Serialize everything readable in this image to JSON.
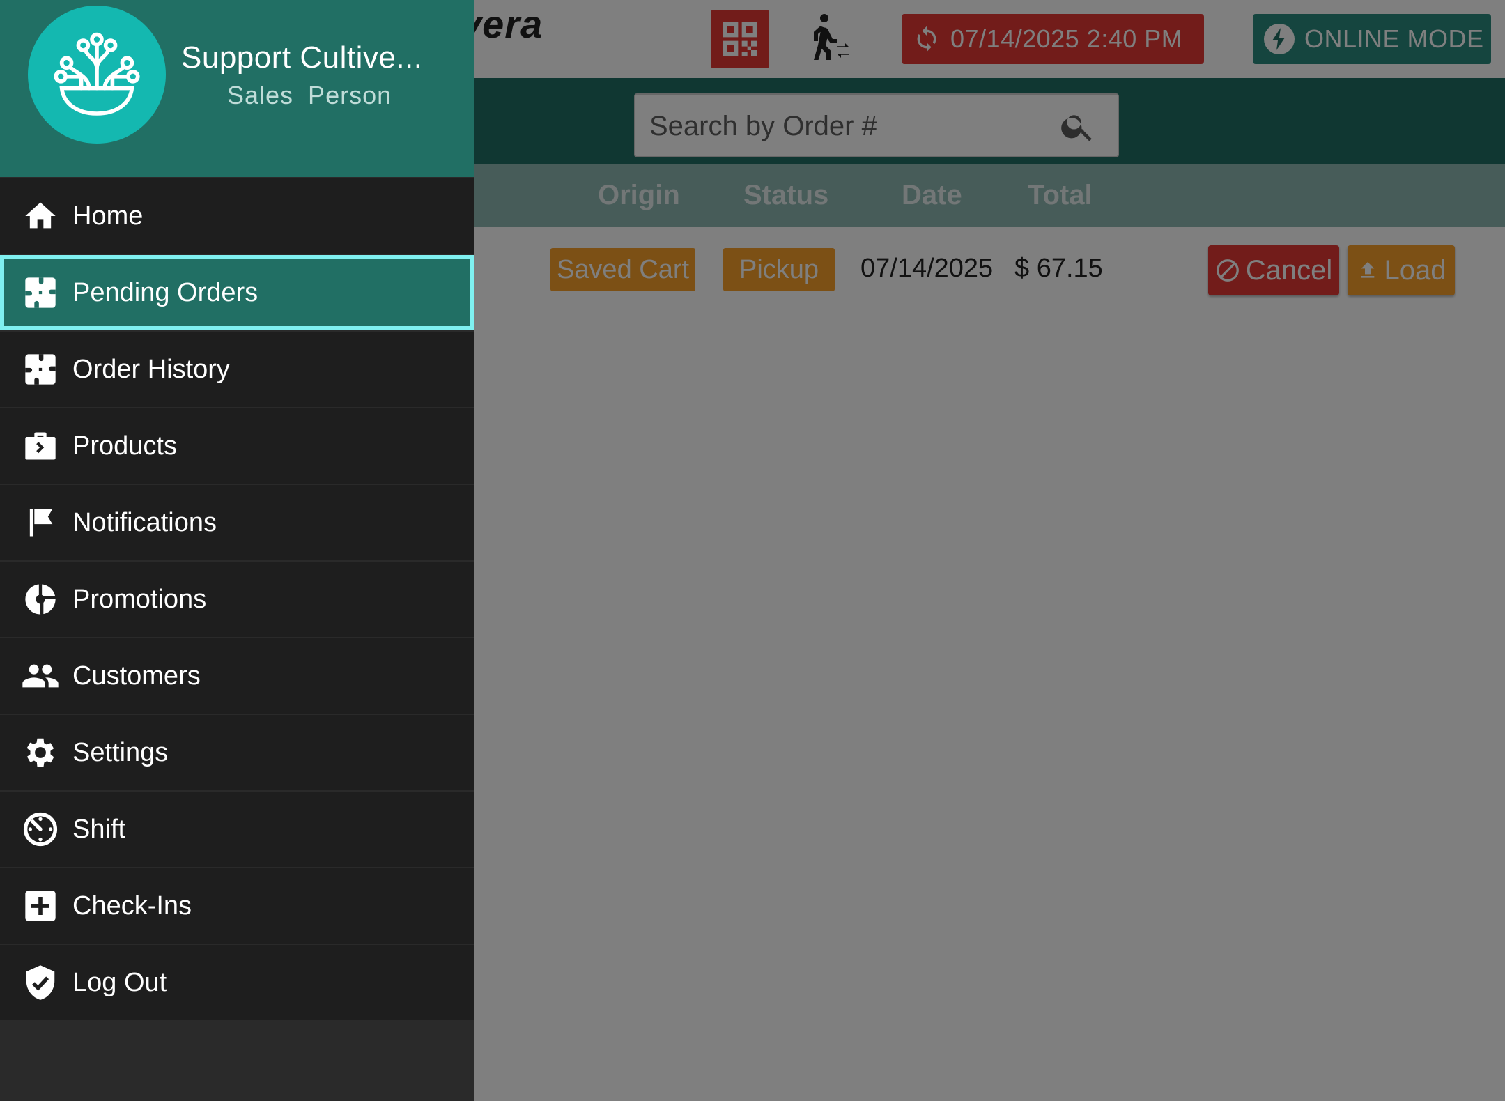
{
  "header": {
    "brand": "vera",
    "sync_datetime": "07/14/2025 2:40 PM",
    "mode_label": "ONLINE MODE"
  },
  "search": {
    "placeholder": "Search by Order #"
  },
  "table": {
    "columns": [
      "Origin",
      "Status",
      "Date",
      "Total"
    ],
    "rows": [
      {
        "origin": "Saved Cart",
        "status": "Pickup",
        "date": "07/14/2025",
        "total": "$ 67.15",
        "cancel_label": "Cancel",
        "load_label": "Load"
      }
    ]
  },
  "drawer": {
    "store_name": "Support Cultive...",
    "user_role": "Sales Person",
    "active_item": "Pending Orders",
    "items": [
      {
        "label": "Home",
        "icon": "home-icon"
      },
      {
        "label": "Pending Orders",
        "icon": "puzzle-icon"
      },
      {
        "label": "Order History",
        "icon": "puzzle-icon"
      },
      {
        "label": "Products",
        "icon": "briefcase-icon"
      },
      {
        "label": "Notifications",
        "icon": "flag-icon"
      },
      {
        "label": "Promotions",
        "icon": "pie-chart-icon"
      },
      {
        "label": "Customers",
        "icon": "people-icon"
      },
      {
        "label": "Settings",
        "icon": "gear-icon"
      },
      {
        "label": "Shift",
        "icon": "timer-icon"
      },
      {
        "label": "Check-Ins",
        "icon": "plus-box-icon"
      },
      {
        "label": "Log Out",
        "icon": "shield-check-icon"
      }
    ]
  },
  "colors": {
    "teal_dark": "#216f64",
    "teal_avatar": "#14b8b0",
    "red": "#e53935",
    "orange": "#f8a12b",
    "drawer_bg": "#1e1e1e",
    "active_border": "#7ff0f0"
  }
}
